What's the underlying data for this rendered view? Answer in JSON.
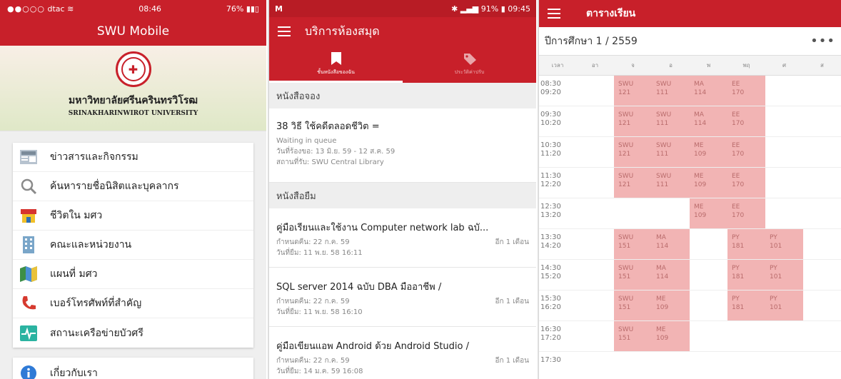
{
  "panel1": {
    "status": {
      "carrier": "dtac",
      "time": "08:46",
      "battery": "76%"
    },
    "title": "SWU Mobile",
    "university_th": "มหาวิทยาลัยศรีนครินทรวิโรฒ",
    "university_en": "SRINAKHARINWIROT UNIVERSITY",
    "menu": [
      {
        "label": "ข่าวสารและกิจกรรม",
        "icon": "news-icon"
      },
      {
        "label": "ค้นหารายชื่อนิสิตและบุคลากร",
        "icon": "search-icon"
      },
      {
        "label": "ชีวิตใน มศว",
        "icon": "store-icon"
      },
      {
        "label": "คณะและหน่วยงาน",
        "icon": "building-icon"
      },
      {
        "label": "แผนที่ มศว",
        "icon": "map-icon"
      },
      {
        "label": "เบอร์โทรศัพท์ที่สำคัญ",
        "icon": "phone-icon"
      },
      {
        "label": "สถานะเครือข่ายบัวศรี",
        "icon": "network-status-icon"
      }
    ],
    "about": "เกี่ยวกับเรา"
  },
  "panel2": {
    "status": {
      "battery": "91%",
      "time": "09:45"
    },
    "title": "บริการห้องสมุด",
    "tabs": [
      {
        "label": "ชั้นหนังสือของฉัน"
      },
      {
        "label": "ประวัติค่าปรับ"
      }
    ],
    "reserved_header": "หนังสือจอง",
    "reserved": [
      {
        "title": "38 วิธี ใช้คดีตลอดชีวิต =",
        "status": "Waiting in queue",
        "request": "วันที่ร้องขอ: 13 มิ.ย. 59 - 12 ส.ค. 59",
        "pickup": "สถานที่รับ: SWU Central Library"
      }
    ],
    "borrowed_header": "หนังสือยืม",
    "borrowed": [
      {
        "title": "คู่มือเรียนและใช้งาน Computer network lab ฉบั...",
        "due": "กำหนดคืน: 22 ก.ค. 59",
        "remain": "อีก 1 เดือน",
        "borrowed": "วันที่ยืม: 11 พ.ย. 58 16:11"
      },
      {
        "title": "SQL server 2014 ฉบับ DBA มืออาชีพ /",
        "due": "กำหนดคืน: 22 ก.ค. 59",
        "remain": "อีก 1 เดือน",
        "borrowed": "วันที่ยืม: 11 พ.ย. 58 16:10"
      },
      {
        "title": "คู่มือเขียนแอพ Android ด้วย Android Studio /",
        "due": "กำหนดคืน: 22 ก.ค. 59",
        "remain": "อีก 1 เดือน",
        "borrowed": "วันที่ยืม: 14 ม.ค. 59 16:08"
      }
    ]
  },
  "panel3": {
    "title": "ตารางเรียน",
    "year": "ปีการศึกษา 1 / 2559",
    "more": "•••",
    "days": [
      "เวลา",
      "อา",
      "จ",
      "อ",
      "พ",
      "พฤ",
      "ศ",
      "ส"
    ],
    "rows": [
      {
        "time": [
          "08:30",
          "09:20"
        ],
        "cells": [
          null,
          [
            "SWU",
            "121"
          ],
          [
            "SWU",
            "111"
          ],
          [
            "MA",
            "114"
          ],
          [
            "EE",
            "170"
          ],
          null,
          null
        ]
      },
      {
        "time": [
          "09:30",
          "10:20"
        ],
        "cells": [
          null,
          [
            "SWU",
            "121"
          ],
          [
            "SWU",
            "111"
          ],
          [
            "MA",
            "114"
          ],
          [
            "EE",
            "170"
          ],
          null,
          null
        ]
      },
      {
        "time": [
          "10:30",
          "11:20"
        ],
        "cells": [
          null,
          [
            "SWU",
            "121"
          ],
          [
            "SWU",
            "111"
          ],
          [
            "ME",
            "109"
          ],
          [
            "EE",
            "170"
          ],
          null,
          null
        ]
      },
      {
        "time": [
          "11:30",
          "12:20"
        ],
        "cells": [
          null,
          [
            "SWU",
            "121"
          ],
          [
            "SWU",
            "111"
          ],
          [
            "ME",
            "109"
          ],
          [
            "EE",
            "170"
          ],
          null,
          null
        ]
      },
      {
        "time": [
          "12:30",
          "13:20"
        ],
        "cells": [
          null,
          null,
          null,
          [
            "ME",
            "109"
          ],
          [
            "EE",
            "170"
          ],
          null,
          null
        ]
      },
      {
        "time": [
          "13:30",
          "14:20"
        ],
        "cells": [
          null,
          [
            "SWU",
            "151"
          ],
          [
            "MA",
            "114"
          ],
          null,
          [
            "PY",
            "181"
          ],
          [
            "PY",
            "101"
          ],
          null
        ]
      },
      {
        "time": [
          "14:30",
          "15:20"
        ],
        "cells": [
          null,
          [
            "SWU",
            "151"
          ],
          [
            "MA",
            "114"
          ],
          null,
          [
            "PY",
            "181"
          ],
          [
            "PY",
            "101"
          ],
          null
        ]
      },
      {
        "time": [
          "15:30",
          "16:20"
        ],
        "cells": [
          null,
          [
            "SWU",
            "151"
          ],
          [
            "ME",
            "109"
          ],
          null,
          [
            "PY",
            "181"
          ],
          [
            "PY",
            "101"
          ],
          null
        ]
      },
      {
        "time": [
          "16:30",
          "17:20"
        ],
        "cells": [
          null,
          [
            "SWU",
            "151"
          ],
          [
            "ME",
            "109"
          ],
          null,
          null,
          null,
          null
        ]
      },
      {
        "time": [
          "17:30",
          ""
        ],
        "cells": [
          null,
          null,
          null,
          null,
          null,
          null,
          null
        ]
      }
    ]
  }
}
